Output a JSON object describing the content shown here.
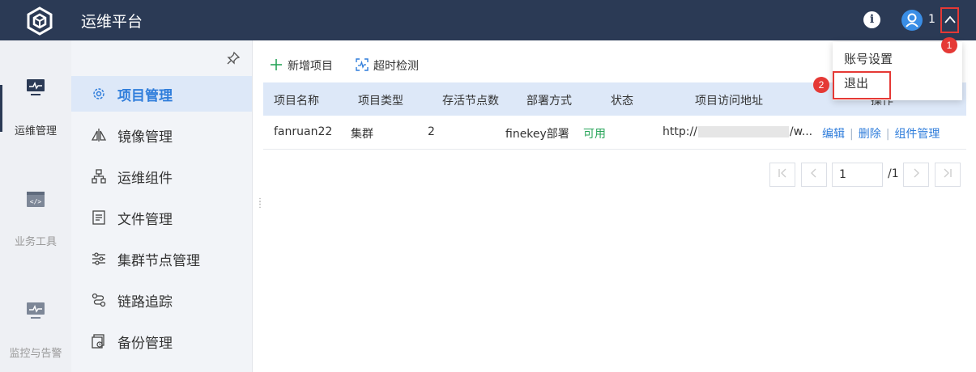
{
  "app": {
    "title": "运维平台"
  },
  "header": {
    "user_count": "1",
    "info_glyph": "i"
  },
  "rail": {
    "items": [
      {
        "label": "运维管理",
        "icon": "monitor-icon",
        "active": true
      },
      {
        "label": "业务工具",
        "icon": "code-window-icon",
        "active": false
      },
      {
        "label": "监控与告警",
        "icon": "monitor-chart-icon",
        "active": false
      }
    ]
  },
  "sidebar": {
    "items": [
      {
        "label": "项目管理",
        "icon": "gear-icon",
        "active": true
      },
      {
        "label": "镜像管理",
        "icon": "mirror-icon"
      },
      {
        "label": "运维组件",
        "icon": "org-chart-icon"
      },
      {
        "label": "文件管理",
        "icon": "document-icon"
      },
      {
        "label": "集群节点管理",
        "icon": "sliders-icon"
      },
      {
        "label": "链路追踪",
        "icon": "trace-icon"
      },
      {
        "label": "备份管理",
        "icon": "backup-icon"
      }
    ]
  },
  "toolbar": {
    "add_label": "新增项目",
    "check_label": "超时检测"
  },
  "table": {
    "headers": [
      "项目名称",
      "项目类型",
      "存活节点数",
      "部署方式",
      "状态",
      "项目访问地址",
      "操作"
    ],
    "rows": [
      {
        "name": "fanruan22",
        "type": "集群",
        "alive_nodes": "2",
        "deploy": "finekey部署",
        "status": "可用",
        "url_prefix": "http://",
        "url_suffix": "/w...",
        "actions": [
          "编辑",
          "删除",
          "组件管理"
        ]
      }
    ]
  },
  "pager": {
    "current_page": "1",
    "total_label": "/1"
  },
  "dropdown": {
    "items": [
      "账号设置",
      "退出"
    ]
  },
  "annotations": {
    "badge_1": "1",
    "badge_2": "2"
  },
  "colors": {
    "header_bg": "#2b3a55",
    "accent": "#2f7ddb",
    "status_ok": "#29a55a",
    "highlight": "#e53935"
  }
}
